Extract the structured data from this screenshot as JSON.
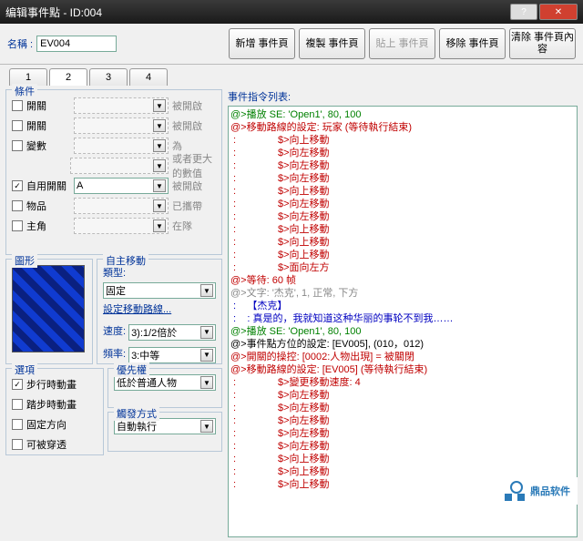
{
  "window": {
    "title": "编辑事件點 - ID:004"
  },
  "name": {
    "label": "名稱 :",
    "value": "EV004"
  },
  "toolbar": {
    "new": "新增\n事件頁",
    "copy": "複製\n事件頁",
    "paste": "貼上\n事件頁",
    "remove": "移除\n事件頁",
    "clear": "清除\n事件頁內容"
  },
  "tabs": [
    "1",
    "2",
    "3",
    "4"
  ],
  "cond": {
    "title": "條件",
    "rows": [
      {
        "ck": false,
        "label": "開關",
        "tail": "被開啟"
      },
      {
        "ck": false,
        "label": "開關",
        "tail": "被開啟"
      },
      {
        "ck": false,
        "label": "變數",
        "tail": "為"
      },
      {
        "ck": false,
        "label": "",
        "tail": "或者更大的數值",
        "indent": true
      },
      {
        "ck": true,
        "label": "自用開關",
        "sel": "A",
        "tail": "被開啟"
      },
      {
        "ck": false,
        "label": "物品",
        "tail": "已攜帶"
      },
      {
        "ck": false,
        "label": "主角",
        "tail": "在隊"
      }
    ]
  },
  "graphic": {
    "title": "圖形"
  },
  "automove": {
    "title": "自主移動",
    "typeLabel": "類型:",
    "type": "固定",
    "routeLink": "設定移動路線...",
    "speedLabel": "速度:",
    "speed": "3):1/2倍於",
    "freqLabel": "頻率:",
    "freq": "3:中等"
  },
  "options": {
    "title": "選項",
    "walk": "步行時動畫",
    "step": "踏步時動畫",
    "fixdir": "固定方向",
    "through": "可被穿透",
    "walk_ck": true,
    "step_ck": false,
    "fixdir_ck": false,
    "through_ck": false
  },
  "priority": {
    "title": "優先權",
    "value": "低於普通人物"
  },
  "trigger": {
    "title": "觸發方式",
    "value": "自動執行"
  },
  "eventLabel": "事件指令列表:",
  "events": [
    {
      "c": "g",
      "t": "@>播放 SE: 'Open1', 80, 100"
    },
    {
      "c": "r",
      "t": "@>移動路線的設定: 玩家 (等待執行結束)"
    },
    {
      "c": "r",
      "t": " :               $>向上移動"
    },
    {
      "c": "r",
      "t": " :               $>向左移動"
    },
    {
      "c": "r",
      "t": " :               $>向左移動"
    },
    {
      "c": "r",
      "t": " :               $>向左移動"
    },
    {
      "c": "r",
      "t": " :               $>向上移動"
    },
    {
      "c": "r",
      "t": " :               $>向左移動"
    },
    {
      "c": "r",
      "t": " :               $>向左移動"
    },
    {
      "c": "r",
      "t": " :               $>向上移動"
    },
    {
      "c": "r",
      "t": " :               $>向上移動"
    },
    {
      "c": "r",
      "t": " :               $>向上移動"
    },
    {
      "c": "r",
      "t": " :               $>面向左方"
    },
    {
      "c": "r",
      "t": "@>等待: 60 帧"
    },
    {
      "c": "gr",
      "t": "@>文字: '杰克', 1, 正常, 下方"
    },
    {
      "c": "b",
      "t": " :    【杰克】"
    },
    {
      "c": "b",
      "t": " :    : 真是的，我就知道这种华丽的事轮不到我……"
    },
    {
      "c": "g",
      "t": "@>播放 SE: 'Open1', 80, 100"
    },
    {
      "c": "k",
      "t": "@>事件點方位的設定: [EV005], (010，012)"
    },
    {
      "c": "r",
      "t": "@>開關的操控: [0002:人物出現] = 被關閉"
    },
    {
      "c": "r",
      "t": "@>移動路線的設定: [EV005] (等待執行結束)"
    },
    {
      "c": "r",
      "t": " :               $>變更移動速度: 4"
    },
    {
      "c": "r",
      "t": " :               $>向左移動"
    },
    {
      "c": "r",
      "t": " :               $>向左移動"
    },
    {
      "c": "r",
      "t": " :               $>向左移動"
    },
    {
      "c": "r",
      "t": " :               $>向左移動"
    },
    {
      "c": "r",
      "t": " :               $>向左移動"
    },
    {
      "c": "r",
      "t": " :               $>向上移動"
    },
    {
      "c": "r",
      "t": " :               $>向上移動"
    },
    {
      "c": "r",
      "t": " :               $>向上移動"
    }
  ],
  "watermark": "鼎品软件"
}
